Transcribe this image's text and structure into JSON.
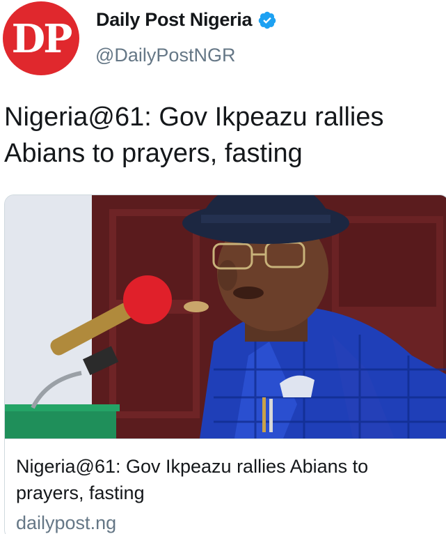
{
  "tweet": {
    "avatar": {
      "text": "DP",
      "color": "#e0282d"
    },
    "author": {
      "display_name": "Daily Post Nigeria",
      "handle": "@DailyPostNGR",
      "verified": true,
      "verified_icon": "verified-badge-icon",
      "verified_color": "#1da1f2"
    },
    "text": "Nigeria@61: Gov Ikpeazu rallies Abians to prayers, fasting",
    "link_card": {
      "image_description_icon": "article-photo",
      "title": "Nigeria@61: Gov Ikpeazu rallies Abians to prayers, fasting",
      "domain": "dailypost.ng"
    }
  }
}
